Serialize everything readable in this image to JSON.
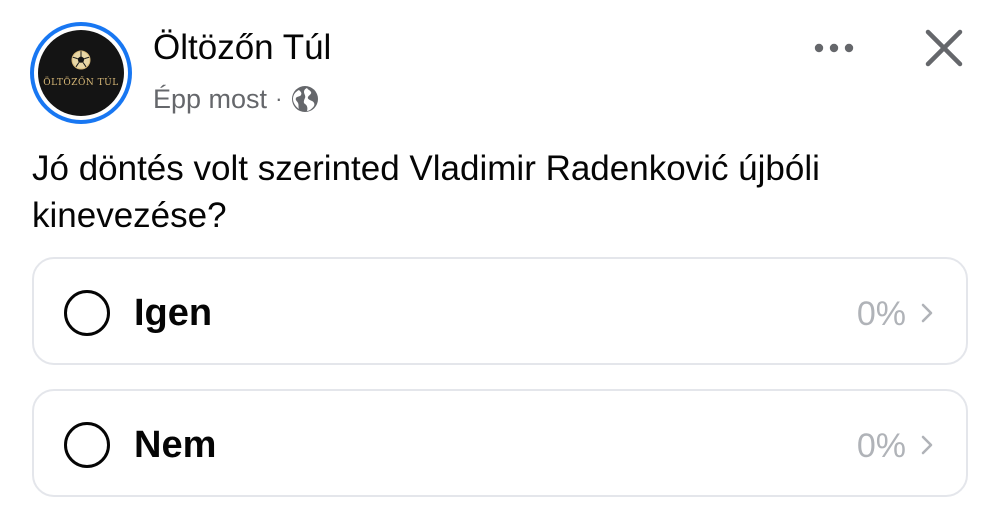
{
  "post": {
    "page_name": "Öltözőn Túl",
    "timestamp": "Épp most",
    "separator": "·",
    "audience_icon": "globe-icon",
    "avatar": {
      "logo_text": "ÖLTÖZŐN TÚL",
      "ring_color": "#1877f2"
    }
  },
  "header_actions": {
    "more_icon": "more-dots-icon",
    "close_icon": "close-icon"
  },
  "poll": {
    "question": "Jó döntés volt szerinted Vladimir Radenković újbóli kinevezése?",
    "options": [
      {
        "label": "Igen",
        "percent": "0%"
      },
      {
        "label": "Nem",
        "percent": "0%"
      }
    ]
  },
  "colors": {
    "text_primary": "#050505",
    "text_secondary": "#65676b",
    "muted": "#b0b3b8",
    "border": "#e4e6eb"
  }
}
